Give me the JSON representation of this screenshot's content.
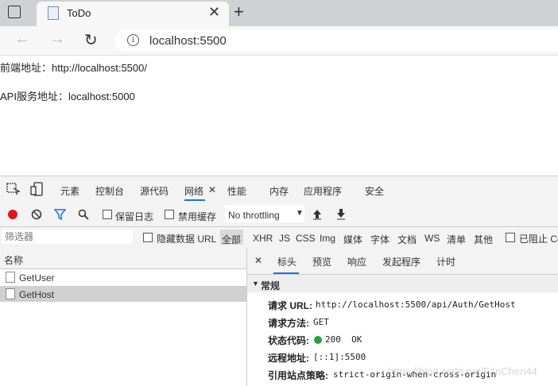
{
  "browser": {
    "tab_title": "ToDo",
    "url": "localhost:5500"
  },
  "page": {
    "frontend_line": "前端地址：http://localhost:5500/",
    "api_line": "API服务地址：localhost:5000"
  },
  "devtools": {
    "tabs": [
      "元素",
      "控制台",
      "源代码",
      "网络",
      "性能",
      "内存",
      "应用程序",
      "安全"
    ],
    "active_tab": "网络",
    "toolbar": {
      "preserve_log": "保留日志",
      "disable_cache": "禁用缓存",
      "throttling": "No throttling"
    },
    "filter": {
      "placeholder": "筛选器",
      "hide_data_urls": "隐藏数据 URL",
      "types": [
        "全部",
        "XHR",
        "JS",
        "CSS",
        "Img",
        "媒体",
        "字体",
        "文档",
        "WS",
        "清单",
        "其他"
      ],
      "blocked": "已阻止 Co"
    },
    "requests": {
      "header": "名称",
      "rows": [
        "GetUser",
        "GetHost"
      ],
      "selected": "GetHost"
    },
    "detail": {
      "tabs": [
        "标头",
        "预览",
        "响应",
        "发起程序",
        "计时"
      ],
      "section": "常规",
      "fields": [
        {
          "label": "请求 URL:",
          "value": "http://localhost:5500/api/Auth/GetHost"
        },
        {
          "label": "请求方法:",
          "value": "GET"
        },
        {
          "label": "状态代码:",
          "value": "200  OK"
        },
        {
          "label": "远程地址:",
          "value": "[::1]:5500"
        },
        {
          "label": "引用站点策略:",
          "value": "strict-origin-when-cross-origin"
        }
      ]
    }
  },
  "watermark": "https://blog.csdn.net/FanChen44",
  "colors": {
    "record": "#e0161e",
    "active_underline": "#1a73e8",
    "status_ok": "#23a33a"
  }
}
